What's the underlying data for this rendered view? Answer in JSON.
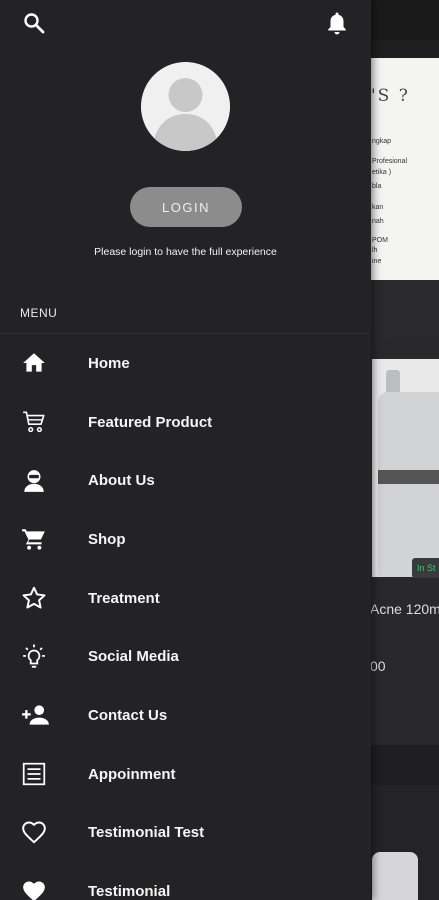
{
  "header": {
    "search_icon": "search-icon",
    "notification_icon": "bell-icon"
  },
  "profile": {
    "avatar_icon": "default-avatar-icon",
    "login_label": "LOGIN",
    "login_hint": "Please login to have the full experience"
  },
  "menu": {
    "section_label": "MENU",
    "items": [
      {
        "label": "Home",
        "icon": "home-icon"
      },
      {
        "label": "Featured Product",
        "icon": "cart-outline-icon"
      },
      {
        "label": "About Us",
        "icon": "person-badge-icon"
      },
      {
        "label": "Shop",
        "icon": "shopping-cart-icon"
      },
      {
        "label": "Treatment",
        "icon": "star-outline-icon"
      },
      {
        "label": "Social Media",
        "icon": "lightbulb-icon"
      },
      {
        "label": "Contact Us",
        "icon": "person-add-icon"
      },
      {
        "label": "Appoinment",
        "icon": "list-icon"
      },
      {
        "label": "Testimonial Test",
        "icon": "heart-outline-icon"
      },
      {
        "label": "Testimonial",
        "icon": "heart-filled-icon"
      }
    ]
  },
  "background": {
    "banner_title": "'S ?",
    "banner_lines": [
      "ngkap",
      "Profesional",
      "etika )",
      "bla",
      "kan",
      "nah",
      "POM",
      "lh",
      "ine"
    ],
    "stock_badge": "In St",
    "product_name": "Acne 120m",
    "product_price": "00"
  }
}
